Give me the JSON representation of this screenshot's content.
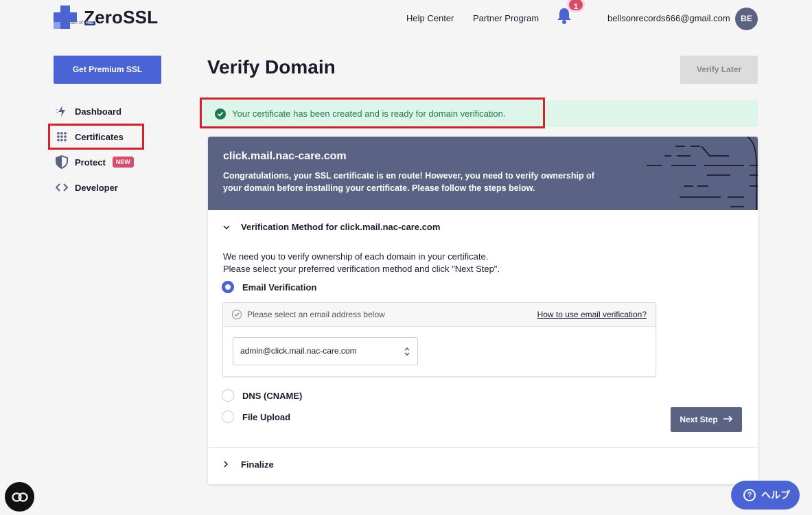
{
  "header": {
    "logo_text": "ZeroSSL",
    "logo_sub": "part of",
    "logo_sub_brand": "HID",
    "help_center": "Help Center",
    "partner_program": "Partner Program",
    "notification_count": "1",
    "user_email": "bellsonrecords666@gmail.com",
    "avatar_initials": "BE"
  },
  "sidebar": {
    "premium_button": "Get Premium SSL",
    "items": [
      {
        "label": "Dashboard"
      },
      {
        "label": "Certificates"
      },
      {
        "label": "Protect",
        "badge": "NEW"
      },
      {
        "label": "Developer"
      }
    ]
  },
  "main": {
    "title": "Verify Domain",
    "verify_later": "Verify Later",
    "alert": "Your certificate has been created and is ready for domain verification.",
    "card": {
      "domain": "click.mail.nac-care.com",
      "description": "Congratulations, your SSL certificate is en route! However, you need to verify ownership of your domain before installing your certificate. Please follow the steps below.",
      "step1_title": "Verification Method for click.mail.nac-care.com",
      "instructions_line1": "We need you to verify ownership of each domain in your certificate.",
      "instructions_line2": "Please select your preferred verification method and click \"Next Step\".",
      "methods": [
        {
          "label": "Email Verification",
          "selected": true
        },
        {
          "label": "DNS (CNAME)",
          "selected": false
        },
        {
          "label": "File Upload",
          "selected": false
        }
      ],
      "email_box_header": "Please select an email address below",
      "email_help_link": "How to use email verification?",
      "email_selected": "admin@click.mail.nac-care.com",
      "next_step": "Next Step",
      "finalize": "Finalize"
    }
  },
  "floating": {
    "help_label": "ヘルプ",
    "help_icon": "?"
  },
  "colors": {
    "brand": "#4a64d6",
    "header_card": "#5a6383",
    "badge": "#d94b6b",
    "alert_bg": "#def5ea",
    "alert_text": "#1f7a4d",
    "highlight": "#d8202a"
  }
}
